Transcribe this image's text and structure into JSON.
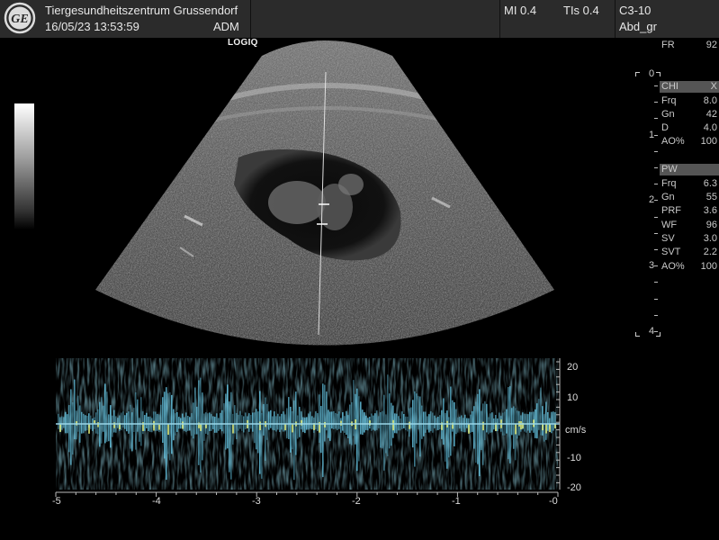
{
  "header": {
    "clinic": "Tiergesundheitszentrum Grussendorf",
    "datetime": "16/05/23 13:53:59",
    "operator": "ADM",
    "mi": "MI 0.4",
    "tis": "TIs 0.4",
    "probe": "C3-10",
    "preset": "Abd_gr"
  },
  "brand": "LOGIQ",
  "icons": {
    "logo": "ge-logo-icon"
  },
  "colors": {
    "doppler": "#6ad0f0",
    "doppler_peak": "#e8f27a",
    "background": "#000000",
    "header": "#2b2b2b"
  },
  "panel": {
    "fr": {
      "label": "FR",
      "value": "92"
    },
    "chi": {
      "label": "CHI",
      "value": "X"
    },
    "chi_params": [
      {
        "label": "Frq",
        "value": "8.0"
      },
      {
        "label": "Gn",
        "value": "42"
      },
      {
        "label": "D",
        "value": "4.0"
      },
      {
        "label": "AO%",
        "value": "100"
      }
    ],
    "pw": {
      "label": "PW",
      "value": ""
    },
    "pw_params": [
      {
        "label": "Frq",
        "value": "6.3"
      },
      {
        "label": "Gn",
        "value": "55"
      },
      {
        "label": "PRF",
        "value": "3.6"
      },
      {
        "label": "WF",
        "value": "96"
      },
      {
        "label": "SV",
        "value": "3.0"
      },
      {
        "label": "SVT",
        "value": "2.2"
      },
      {
        "label": "AO%",
        "value": "100"
      }
    ]
  },
  "depth_scale": [
    "0",
    "1",
    "2",
    "3",
    "4"
  ],
  "doppler": {
    "velocity_labels": [
      "20",
      "10",
      "cm/s",
      "-10",
      "-20"
    ],
    "time_labels": [
      "-5",
      "-4",
      "-3",
      "-2",
      "-1",
      "-0"
    ]
  }
}
